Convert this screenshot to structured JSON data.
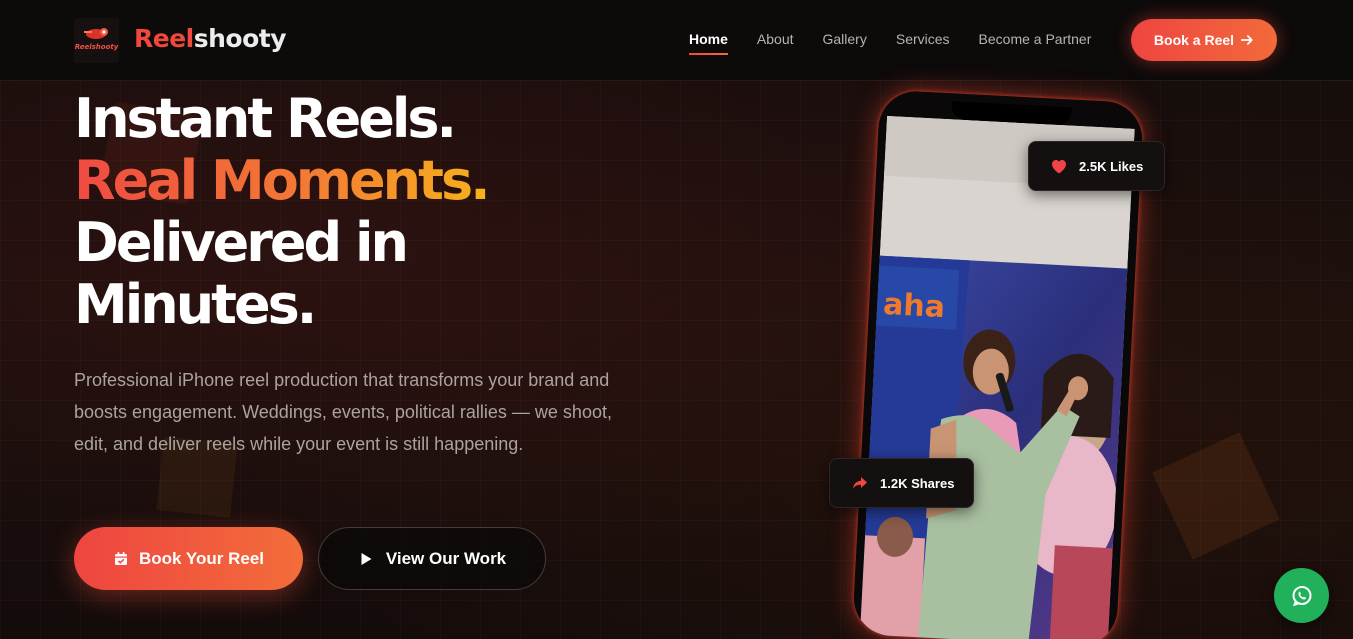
{
  "brand": {
    "part1": "Reel",
    "part2": "shooty",
    "logo_text": "Reelshooty"
  },
  "nav": {
    "items": [
      {
        "label": "Home",
        "active": true
      },
      {
        "label": "About"
      },
      {
        "label": "Gallery"
      },
      {
        "label": "Services"
      },
      {
        "label": "Become a Partner"
      }
    ],
    "cta_label": "Book a Reel",
    "cta_icon": "arrow-right-icon"
  },
  "hero": {
    "line1": "Instant Reels.",
    "line2": "Real Moments.",
    "line3": "Delivered in",
    "line4": "Minutes.",
    "description": "Professional iPhone reel production that transforms your brand and boosts engagement. Weddings, events, political rallies — we shoot, edit, and deliver reels while your event is still happening.",
    "primary_button": "Book Your Reel",
    "primary_icon": "calendar-icon",
    "secondary_button": "View Our Work",
    "secondary_icon": "play-icon"
  },
  "phone": {
    "stage_logo_text": "aha",
    "likes": "2.5K Likes",
    "likes_icon": "heart-icon",
    "shares": "1.2K Shares",
    "shares_icon": "share-icon"
  },
  "fab": {
    "icon": "whatsapp-icon"
  },
  "colors": {
    "accent": "#f0483e",
    "accent_orange": "#f36b3a",
    "accent_yellow": "#f7b21c",
    "background": "#120c0b",
    "whatsapp": "#20b15a"
  }
}
